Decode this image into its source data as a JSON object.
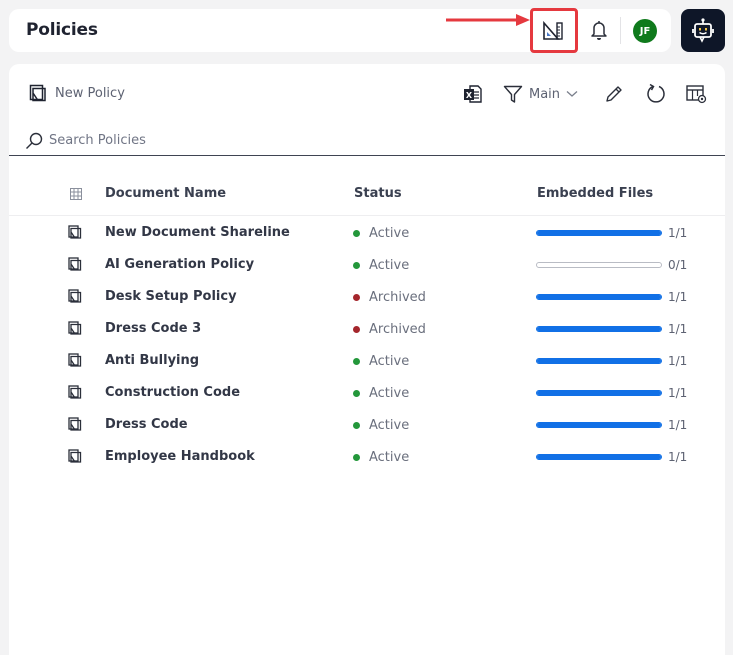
{
  "header": {
    "title": "Policies",
    "user_initials": "JF",
    "icons": [
      "ruler-triangle-icon",
      "bell-icon",
      "chatbot-icon"
    ],
    "avatar_color": "#0f7a1c",
    "highlight_color": "#e5393f"
  },
  "toolbar": {
    "new_policy_label": "New Policy",
    "filter_label": "Main",
    "icons": [
      "excel-export-icon",
      "filter-icon",
      "edit-icon",
      "refresh-icon",
      "column-settings-icon"
    ]
  },
  "search": {
    "placeholder": "Search Policies",
    "value": ""
  },
  "table": {
    "columns": [
      "Document Name",
      "Status",
      "Embedded Files"
    ],
    "rows": [
      {
        "name": "New Document Shareline",
        "status": "Active",
        "files_done": 1,
        "files_total": 1,
        "files_label": "1/1"
      },
      {
        "name": "AI Generation Policy",
        "status": "Active",
        "files_done": 0,
        "files_total": 1,
        "files_label": "0/1"
      },
      {
        "name": "Desk Setup Policy",
        "status": "Archived",
        "files_done": 1,
        "files_total": 1,
        "files_label": "1/1"
      },
      {
        "name": "Dress Code 3",
        "status": "Archived",
        "files_done": 1,
        "files_total": 1,
        "files_label": "1/1"
      },
      {
        "name": "Anti Bullying",
        "status": "Active",
        "files_done": 1,
        "files_total": 1,
        "files_label": "1/1"
      },
      {
        "name": "Construction Code",
        "status": "Active",
        "files_done": 1,
        "files_total": 1,
        "files_label": "1/1"
      },
      {
        "name": "Dress Code",
        "status": "Active",
        "files_done": 1,
        "files_total": 1,
        "files_label": "1/1"
      },
      {
        "name": "Employee Handbook",
        "status": "Active",
        "files_done": 1,
        "files_total": 1,
        "files_label": "1/1"
      }
    ]
  },
  "status_colors": {
    "Active": "#23973a",
    "Archived": "#a4262c"
  },
  "progress_color": "#1170e6"
}
